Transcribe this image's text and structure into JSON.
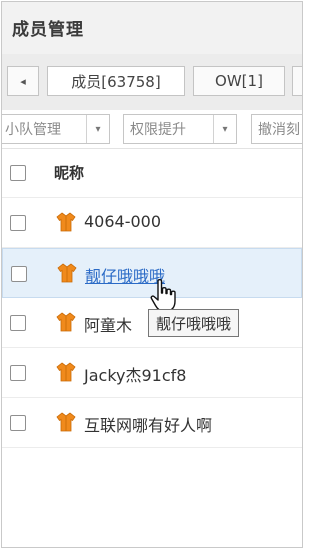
{
  "window": {
    "title": "成员管理"
  },
  "tabs": {
    "prev_arrow": "◂",
    "items": [
      {
        "label": "成员[63758]",
        "active": true
      },
      {
        "label": "OW[1]",
        "active": false
      }
    ]
  },
  "toolbar": {
    "team_manage": "小队管理",
    "permission_up": "权限提升",
    "revoke": "撤消刻",
    "caret": "▾"
  },
  "list": {
    "header": "昵称",
    "members": [
      {
        "nickname": "4064-000"
      },
      {
        "nickname": "靓仔哦哦哦",
        "selected": true
      },
      {
        "nickname": "阿童木"
      },
      {
        "nickname": "Jacky杰91cf8"
      },
      {
        "nickname": "互联网哪有好人啊"
      }
    ]
  },
  "tooltip": {
    "text": "靓仔哦哦哦"
  },
  "icons": {
    "member_icon": "orange-shirt-icon",
    "cursor": "hand-pointer-icon"
  },
  "colors": {
    "member_icon": "#f08a1c",
    "selected_row": "#e5f0fa",
    "link": "#2a6ac6"
  }
}
